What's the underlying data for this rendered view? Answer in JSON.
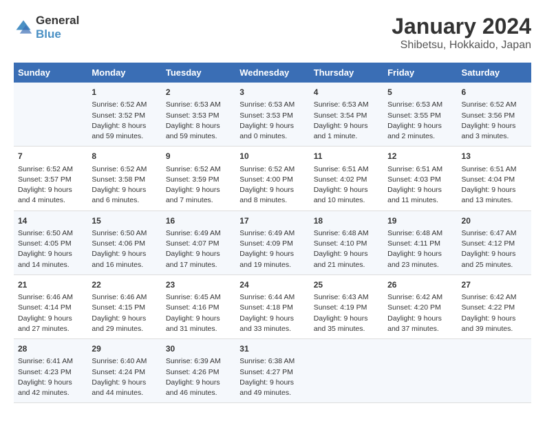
{
  "header": {
    "logo_line1": "General",
    "logo_line2": "Blue",
    "main_title": "January 2024",
    "subtitle": "Shibetsu, Hokkaido, Japan"
  },
  "weekdays": [
    "Sunday",
    "Monday",
    "Tuesday",
    "Wednesday",
    "Thursday",
    "Friday",
    "Saturday"
  ],
  "weeks": [
    [
      {
        "day": "",
        "info": ""
      },
      {
        "day": "1",
        "info": "Sunrise: 6:52 AM\nSunset: 3:52 PM\nDaylight: 8 hours\nand 59 minutes."
      },
      {
        "day": "2",
        "info": "Sunrise: 6:53 AM\nSunset: 3:53 PM\nDaylight: 8 hours\nand 59 minutes."
      },
      {
        "day": "3",
        "info": "Sunrise: 6:53 AM\nSunset: 3:53 PM\nDaylight: 9 hours\nand 0 minutes."
      },
      {
        "day": "4",
        "info": "Sunrise: 6:53 AM\nSunset: 3:54 PM\nDaylight: 9 hours\nand 1 minute."
      },
      {
        "day": "5",
        "info": "Sunrise: 6:53 AM\nSunset: 3:55 PM\nDaylight: 9 hours\nand 2 minutes."
      },
      {
        "day": "6",
        "info": "Sunrise: 6:52 AM\nSunset: 3:56 PM\nDaylight: 9 hours\nand 3 minutes."
      }
    ],
    [
      {
        "day": "7",
        "info": "Sunrise: 6:52 AM\nSunset: 3:57 PM\nDaylight: 9 hours\nand 4 minutes."
      },
      {
        "day": "8",
        "info": "Sunrise: 6:52 AM\nSunset: 3:58 PM\nDaylight: 9 hours\nand 6 minutes."
      },
      {
        "day": "9",
        "info": "Sunrise: 6:52 AM\nSunset: 3:59 PM\nDaylight: 9 hours\nand 7 minutes."
      },
      {
        "day": "10",
        "info": "Sunrise: 6:52 AM\nSunset: 4:00 PM\nDaylight: 9 hours\nand 8 minutes."
      },
      {
        "day": "11",
        "info": "Sunrise: 6:51 AM\nSunset: 4:02 PM\nDaylight: 9 hours\nand 10 minutes."
      },
      {
        "day": "12",
        "info": "Sunrise: 6:51 AM\nSunset: 4:03 PM\nDaylight: 9 hours\nand 11 minutes."
      },
      {
        "day": "13",
        "info": "Sunrise: 6:51 AM\nSunset: 4:04 PM\nDaylight: 9 hours\nand 13 minutes."
      }
    ],
    [
      {
        "day": "14",
        "info": "Sunrise: 6:50 AM\nSunset: 4:05 PM\nDaylight: 9 hours\nand 14 minutes."
      },
      {
        "day": "15",
        "info": "Sunrise: 6:50 AM\nSunset: 4:06 PM\nDaylight: 9 hours\nand 16 minutes."
      },
      {
        "day": "16",
        "info": "Sunrise: 6:49 AM\nSunset: 4:07 PM\nDaylight: 9 hours\nand 17 minutes."
      },
      {
        "day": "17",
        "info": "Sunrise: 6:49 AM\nSunset: 4:09 PM\nDaylight: 9 hours\nand 19 minutes."
      },
      {
        "day": "18",
        "info": "Sunrise: 6:48 AM\nSunset: 4:10 PM\nDaylight: 9 hours\nand 21 minutes."
      },
      {
        "day": "19",
        "info": "Sunrise: 6:48 AM\nSunset: 4:11 PM\nDaylight: 9 hours\nand 23 minutes."
      },
      {
        "day": "20",
        "info": "Sunrise: 6:47 AM\nSunset: 4:12 PM\nDaylight: 9 hours\nand 25 minutes."
      }
    ],
    [
      {
        "day": "21",
        "info": "Sunrise: 6:46 AM\nSunset: 4:14 PM\nDaylight: 9 hours\nand 27 minutes."
      },
      {
        "day": "22",
        "info": "Sunrise: 6:46 AM\nSunset: 4:15 PM\nDaylight: 9 hours\nand 29 minutes."
      },
      {
        "day": "23",
        "info": "Sunrise: 6:45 AM\nSunset: 4:16 PM\nDaylight: 9 hours\nand 31 minutes."
      },
      {
        "day": "24",
        "info": "Sunrise: 6:44 AM\nSunset: 4:18 PM\nDaylight: 9 hours\nand 33 minutes."
      },
      {
        "day": "25",
        "info": "Sunrise: 6:43 AM\nSunset: 4:19 PM\nDaylight: 9 hours\nand 35 minutes."
      },
      {
        "day": "26",
        "info": "Sunrise: 6:42 AM\nSunset: 4:20 PM\nDaylight: 9 hours\nand 37 minutes."
      },
      {
        "day": "27",
        "info": "Sunrise: 6:42 AM\nSunset: 4:22 PM\nDaylight: 9 hours\nand 39 minutes."
      }
    ],
    [
      {
        "day": "28",
        "info": "Sunrise: 6:41 AM\nSunset: 4:23 PM\nDaylight: 9 hours\nand 42 minutes."
      },
      {
        "day": "29",
        "info": "Sunrise: 6:40 AM\nSunset: 4:24 PM\nDaylight: 9 hours\nand 44 minutes."
      },
      {
        "day": "30",
        "info": "Sunrise: 6:39 AM\nSunset: 4:26 PM\nDaylight: 9 hours\nand 46 minutes."
      },
      {
        "day": "31",
        "info": "Sunrise: 6:38 AM\nSunset: 4:27 PM\nDaylight: 9 hours\nand 49 minutes."
      },
      {
        "day": "",
        "info": ""
      },
      {
        "day": "",
        "info": ""
      },
      {
        "day": "",
        "info": ""
      }
    ]
  ]
}
